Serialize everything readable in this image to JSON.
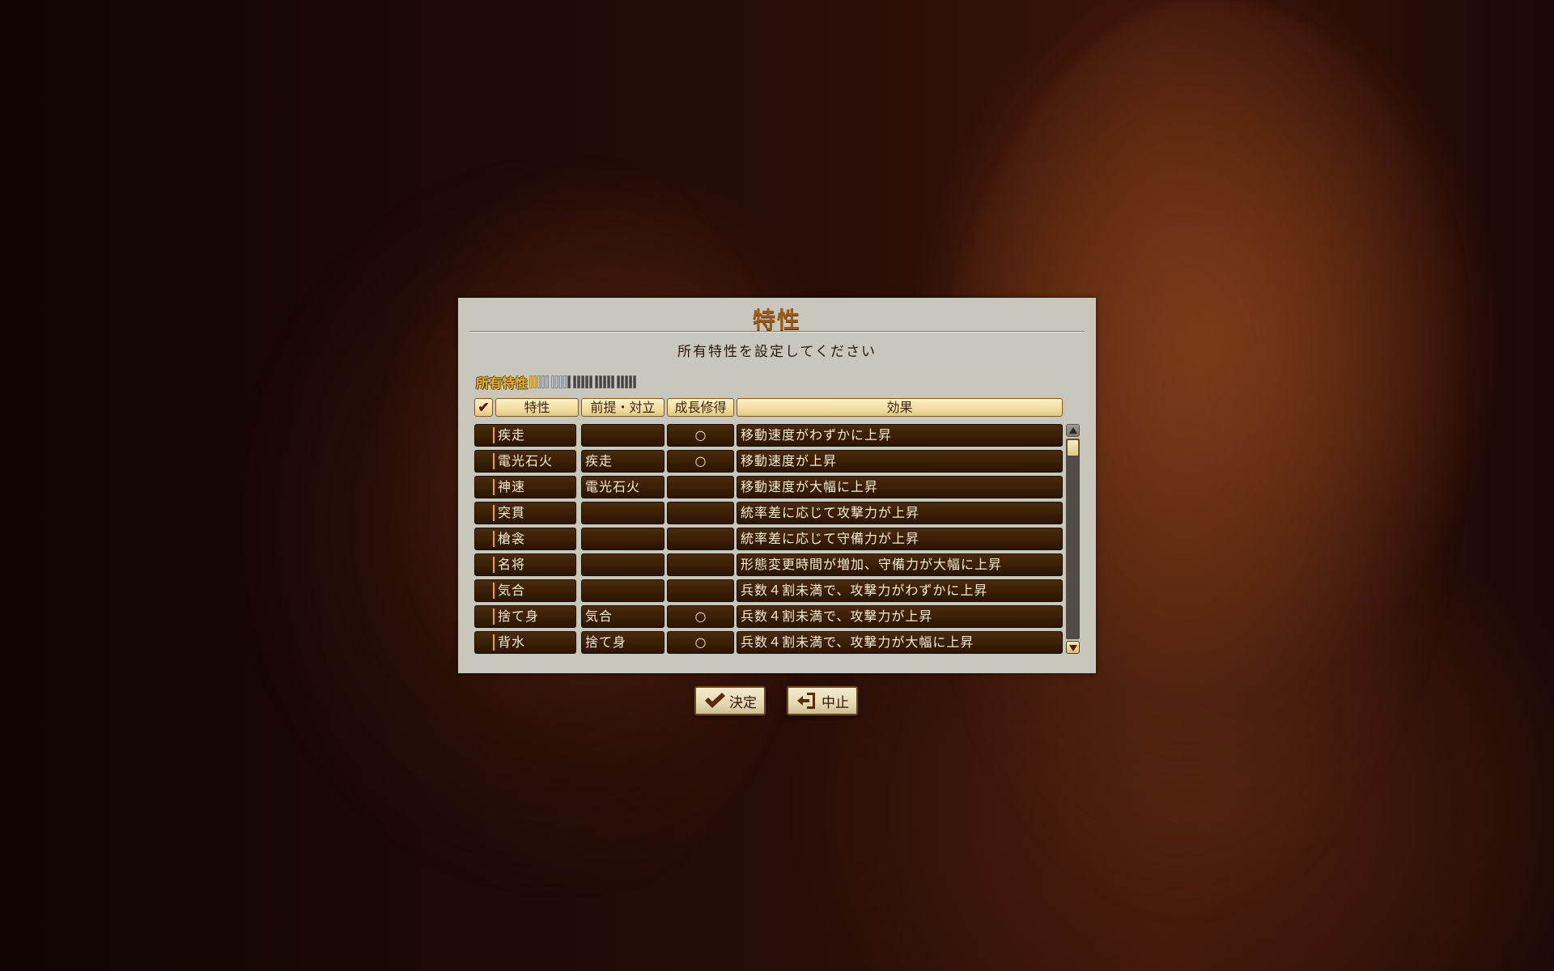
{
  "dialog": {
    "title": "特性",
    "instruction": "所有特性を設定してください",
    "owned_label": "所有特性",
    "owned_slots": {
      "filled": 2,
      "available": 7,
      "locked": 16,
      "total": 25
    }
  },
  "table": {
    "columns": {
      "check": "✔",
      "trait": "特性",
      "prereq": "前提・対立",
      "growth": "成長修得",
      "effect": "効果"
    },
    "rows": [
      {
        "trait": "疾走",
        "prereq": "",
        "growth": "○",
        "effect": "移動速度がわずかに上昇"
      },
      {
        "trait": "電光石火",
        "prereq": "疾走",
        "growth": "○",
        "effect": "移動速度が上昇"
      },
      {
        "trait": "神速",
        "prereq": "電光石火",
        "growth": "",
        "effect": "移動速度が大幅に上昇"
      },
      {
        "trait": "突貫",
        "prereq": "",
        "growth": "",
        "effect": "統率差に応じて攻撃力が上昇"
      },
      {
        "trait": "槍衾",
        "prereq": "",
        "growth": "",
        "effect": "統率差に応じて守備力が上昇"
      },
      {
        "trait": "名将",
        "prereq": "",
        "growth": "",
        "effect": "形態変更時間が増加、守備力が大幅に上昇"
      },
      {
        "trait": "気合",
        "prereq": "",
        "growth": "",
        "effect": "兵数４割未満で、攻撃力がわずかに上昇"
      },
      {
        "trait": "捨て身",
        "prereq": "気合",
        "growth": "○",
        "effect": "兵数４割未満で、攻撃力が上昇"
      },
      {
        "trait": "背水",
        "prereq": "捨て身",
        "growth": "○",
        "effect": "兵数４割未満で、攻撃力が大幅に上昇"
      }
    ]
  },
  "buttons": {
    "confirm": "決定",
    "cancel": "中止"
  },
  "icons": {
    "confirm": "checkmark-icon",
    "cancel": "exit-door-icon",
    "scroll_up": "triangle-up-icon",
    "scroll_down": "triangle-down-icon"
  },
  "colors": {
    "panel_bg": "#c9c6bb",
    "title": "#9a5a14",
    "row_bg": "#3a1f06",
    "header_bg": "#f1dd9e",
    "slot_filled": "#e8b428"
  }
}
